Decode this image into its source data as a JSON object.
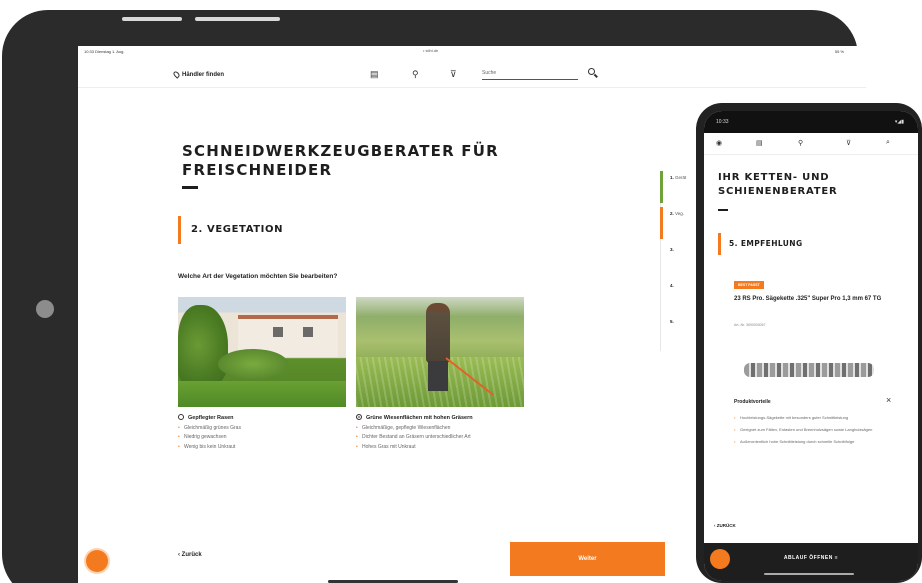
{
  "tablet": {
    "status_time": "10:33  Dienstag 1. Aug.",
    "url": "• stihl.de",
    "battery": "55 %",
    "nav": {
      "dealer_label": "Händler finden",
      "search_placeholder": "Suche"
    },
    "page_title": "SCHNEIDWERKZEUGBERATER FÜR FREISCHNEIDER",
    "step_title": "2. VEGETATION",
    "question": "Welche Art der Vegetation möchten Sie bearbeiten?",
    "options": [
      {
        "label": "Gepflegter Rasen",
        "selected": false,
        "bullets": [
          "Gleichmäßig grünes Gras",
          "Niedrig gewachsen",
          "Wenig bis kein Unkraut"
        ]
      },
      {
        "label": "Grüne Wiesenflächen mit hohen Gräsern",
        "selected": true,
        "bullets": [
          "Gleichmäßige, gepflegte Wiesenflächen",
          "Dichter Bestand an Gräsern unterschiedlicher Art",
          "Hohes Gras mit Unkraut"
        ]
      }
    ],
    "progress": [
      {
        "num": "1.",
        "label": "Gerät",
        "state": "done"
      },
      {
        "num": "2.",
        "label": "Veg.",
        "state": "active"
      },
      {
        "num": "3.",
        "label": "",
        "state": "todo"
      },
      {
        "num": "4.",
        "label": "",
        "state": "todo"
      },
      {
        "num": "5.",
        "label": "",
        "state": "todo"
      }
    ],
    "back_label": "Zurück",
    "next_label": "Weiter"
  },
  "phone": {
    "status_time": "10:33",
    "status_icons": "▾◢▮",
    "page_title": "IHR KETTEN- UND SCHIENENBERATER",
    "step_title": "5. EMPFEHLUNG",
    "badge": "BEST PASST",
    "product_name": "23 RS Pro. Sägekette .325\" Super Pro 1,3 mm 67 TG",
    "article": "Art.-Nr. 3690000067",
    "features_title": "Produktvorteile",
    "features": [
      "Hochleistungs-Sägekette mit besonders guter Schnittleistung",
      "Geeignet zum Fällen, Entasten und Brennholzsägen sowie Langholzsägen",
      "Außerordentlich hohe Schnittleistung durch schnelle Schnittfolge"
    ],
    "back_label": "ZURÜCK",
    "bottom_label": "ABLAUF ÖFFNEN ≡"
  },
  "colors": {
    "accent": "#f37a1f",
    "done": "#6fa33a",
    "text": "#1e1e1e",
    "device_frame": "#2b2b2b"
  }
}
